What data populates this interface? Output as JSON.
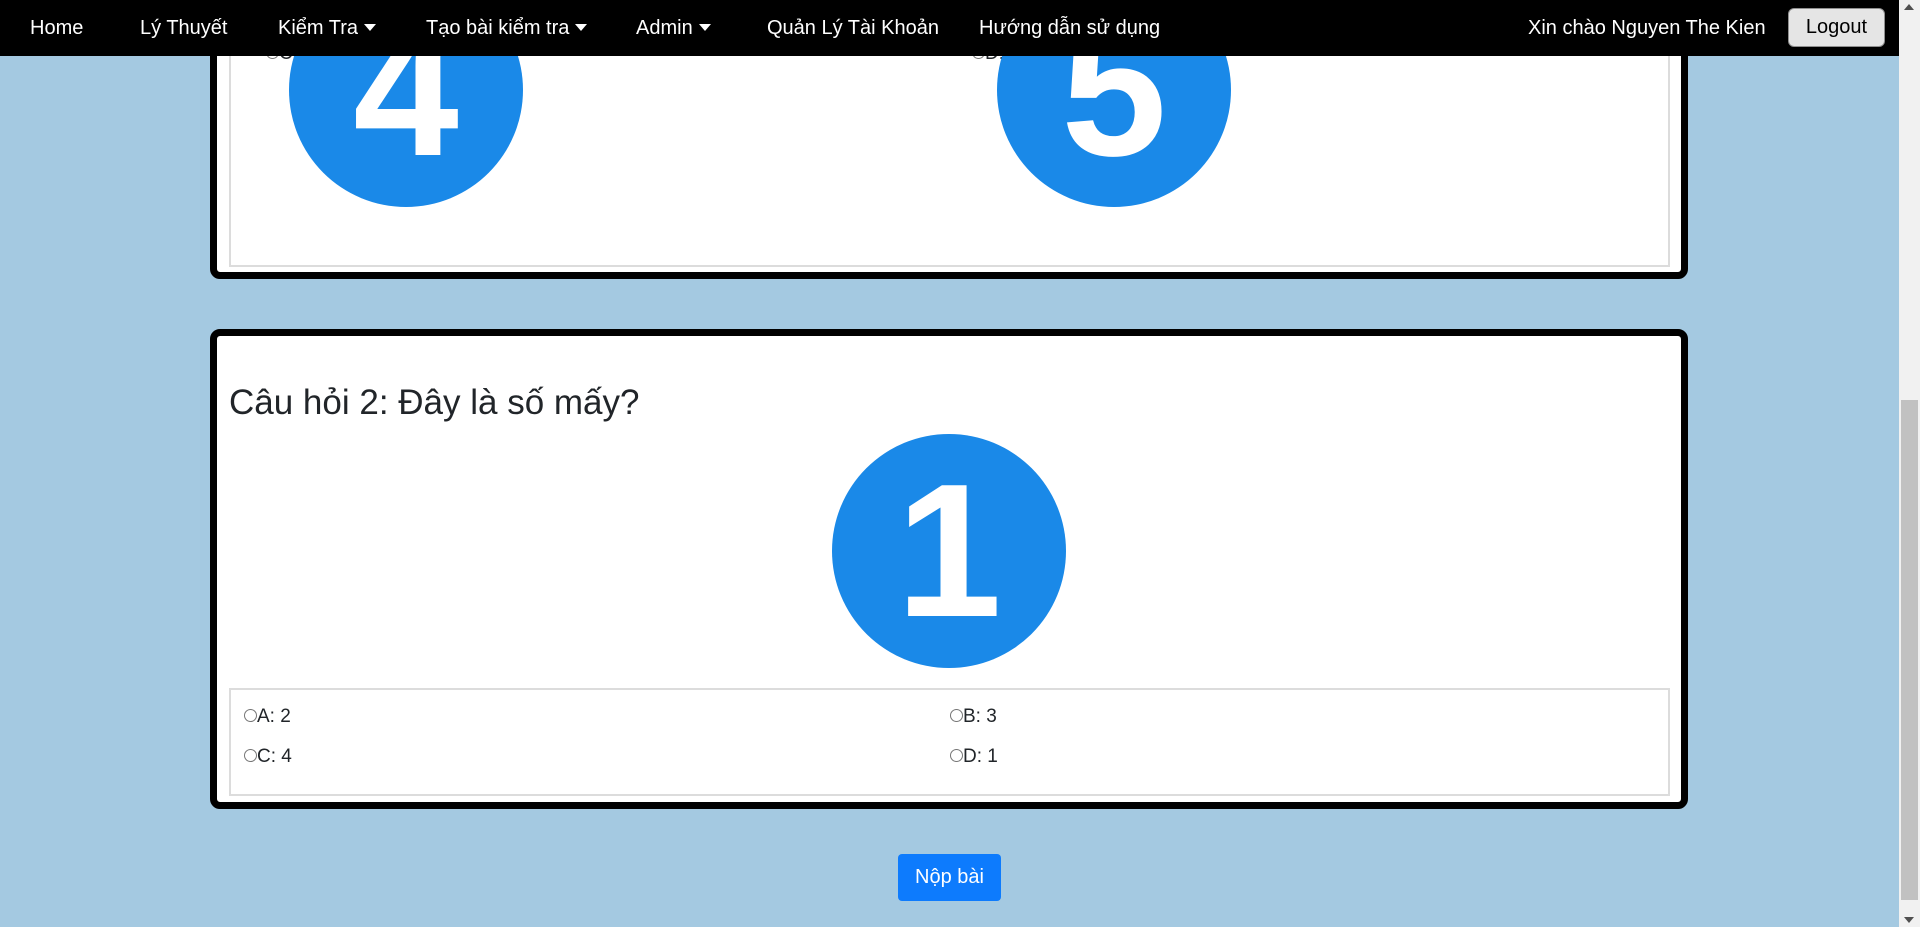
{
  "navbar": {
    "items": [
      {
        "label": "Home",
        "dropdown": false
      },
      {
        "label": "Lý Thuyết",
        "dropdown": false
      },
      {
        "label": "Kiểm Tra",
        "dropdown": true
      },
      {
        "label": "Tạo bài kiểm tra",
        "dropdown": true
      },
      {
        "label": "Admin",
        "dropdown": true
      },
      {
        "label": "Quản Lý Tài Khoản",
        "dropdown": false
      },
      {
        "label": "Hướng dẫn sử dụng",
        "dropdown": false
      }
    ],
    "greeting": "Xin chào Nguyen The Kien",
    "logout_label": "Logout"
  },
  "question1": {
    "options": [
      {
        "label": "C:",
        "image_number": "4"
      },
      {
        "label": "D:",
        "image_number": "5"
      }
    ]
  },
  "question2": {
    "title": "Câu hỏi 2: Đây là số mấy?",
    "image_number": "1",
    "options": [
      {
        "label": "A: 2"
      },
      {
        "label": "B: 3"
      },
      {
        "label": "C: 4"
      },
      {
        "label": "D: 1"
      }
    ]
  },
  "submit_label": "Nộp bài",
  "colors": {
    "background": "#a4c9e1",
    "navbar": "#000000",
    "number_circle": "#1a89e8",
    "submit_button": "#0d7bfd"
  }
}
